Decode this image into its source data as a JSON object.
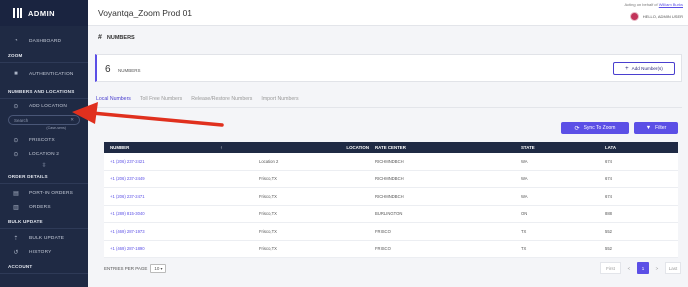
{
  "sidebar": {
    "brand": "ADMIN",
    "dashboard": "DASHBOARD",
    "section_zoom": "ZOOM",
    "authentication": "AUTHENTICATION",
    "section_numbers": "NUMBERS AND LOCATIONS",
    "add_location": "ADD LOCATION",
    "search_placeholder": "Search",
    "case_sensitive": "(Case-sens)",
    "loc_frisco": "FRISCOTX",
    "loc_location2": "LOCATION 2",
    "section_order": "ORDER DETAILS",
    "port_in": "PORT-IN ORDERS",
    "orders": "ORDERS",
    "section_bulk": "BULK UPDATE",
    "bulk_update": "BULK UPDATE",
    "history": "HISTORY",
    "section_account": "ACCOUNT"
  },
  "topbar": {
    "title": "Voyantqa_Zoom Prod 01",
    "acting_prefix": "Acting on behalf of",
    "acting_user": "William Burks",
    "hello": "HELLO, ADMIN USER"
  },
  "page": {
    "title": "NUMBERS",
    "count": "6",
    "count_label": "NUMBERS",
    "add_button": "Add Number(s)"
  },
  "tabs": [
    "Local Numbers",
    "Toll Free Numbers",
    "Release/Restore Numbers",
    "Import Numbers"
  ],
  "actions": {
    "sync": "Sync To Zoom",
    "filter": "Filter"
  },
  "table": {
    "headers": [
      "NUMBER",
      "LOCATION",
      "RATE CENTER",
      "STATE",
      "LATA"
    ],
    "rows": [
      [
        "+1 (206) 237-2421",
        "Location 2",
        "RICHMNDBCH",
        "WA",
        "674"
      ],
      [
        "+1 (206) 237-2449",
        "Frisco,TX",
        "RICHMNDBCH",
        "WA",
        "674"
      ],
      [
        "+1 (206) 237-2471",
        "Frisco,TX",
        "RICHMNDBCH",
        "WA",
        "674"
      ],
      [
        "+1 (289) 815-3040",
        "Frisco,TX",
        "BURLINGTON",
        "ON",
        "888"
      ],
      [
        "+1 (469) 287-1973",
        "Frisco,TX",
        "FRISCO",
        "TX",
        "552"
      ],
      [
        "+1 (469) 287-1890",
        "Frisco,TX",
        "FRISCO",
        "TX",
        "552"
      ]
    ]
  },
  "footer": {
    "entries_label": "ENTRIES PER PAGE",
    "entries_value": "10",
    "first": "First",
    "prev": "<",
    "page": "1",
    "next": ">",
    "last": "Last"
  },
  "colors": {
    "accent": "#5b4fe6",
    "sidebar": "#1f2a44",
    "arrow": "#e0301e"
  }
}
